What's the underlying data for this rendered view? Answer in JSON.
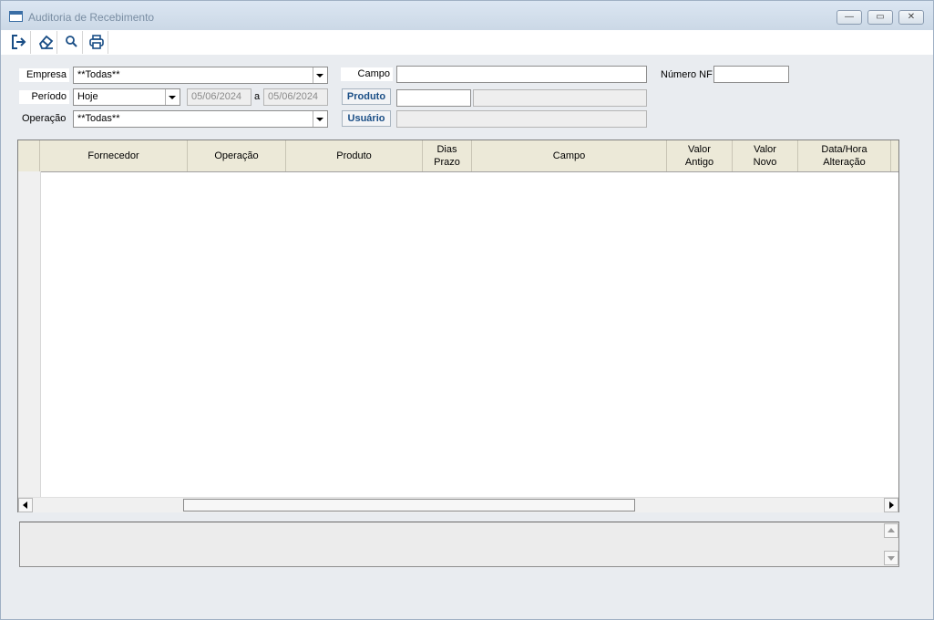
{
  "window": {
    "title": "Auditoria de Recebimento",
    "controls": {
      "minimize": "—",
      "restore": "▭",
      "close": "✕"
    }
  },
  "toolbar": {
    "buttons": [
      {
        "icon": "exit-icon"
      },
      {
        "icon": "eraser-icon"
      },
      {
        "icon": "search-icon"
      },
      {
        "icon": "printer-icon"
      }
    ]
  },
  "filters": {
    "empresa_label": "Empresa",
    "empresa_value": "**Todas**",
    "periodo_label": "Período",
    "periodo_value": "Hoje",
    "date_from": "05/06/2024",
    "date_sep": "a",
    "date_to": "05/06/2024",
    "operacao_label": "Operação",
    "operacao_value": "**Todas**",
    "campo_label": "Campo",
    "campo_value": "",
    "numero_nf_label": "Número NF",
    "numero_nf_value": "",
    "produto_button": "Produto",
    "produto_code": "",
    "produto_desc": "",
    "usuario_button": "Usuário",
    "usuario_value": ""
  },
  "grid": {
    "columns": [
      "Fornecedor",
      "Operação",
      "Produto",
      "Dias\nPrazo",
      "Campo",
      "Valor\nAntigo",
      "Valor\nNovo",
      "Data/Hora\nAlteração"
    ],
    "rows": []
  },
  "scroll": {
    "left": "◀",
    "right": "▶",
    "up": "▲",
    "down": "▼"
  },
  "colors": {
    "link": "#1a4e86",
    "title_text": "#7a8ea3",
    "header_bg": "#ece9d8"
  }
}
